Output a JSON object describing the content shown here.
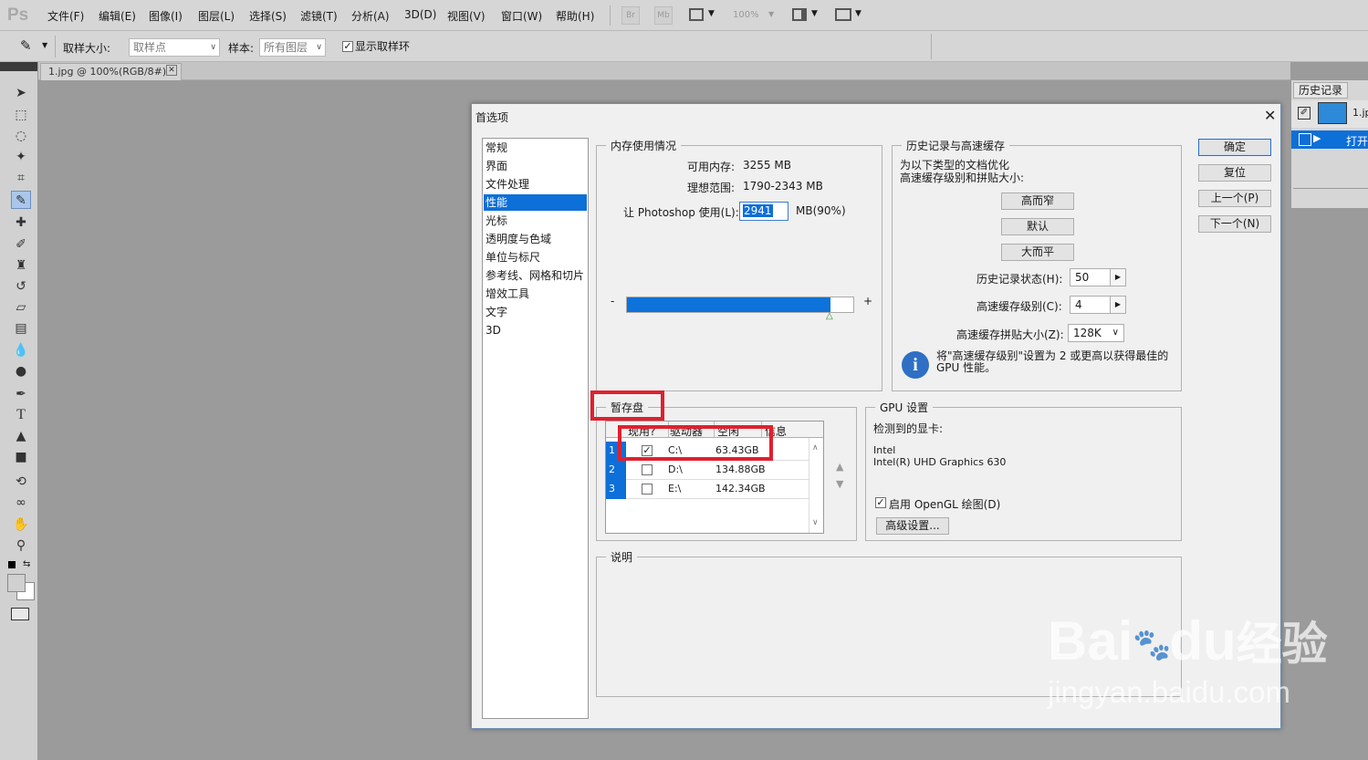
{
  "app": {
    "logo": "Ps"
  },
  "menu": [
    "文件(F)",
    "编辑(E)",
    "图像(I)",
    "图层(L)",
    "选择(S)",
    "滤镜(T)",
    "分析(A)",
    "3D(D)",
    "视图(V)",
    "窗口(W)",
    "帮助(H)"
  ],
  "menubar_buttons": {
    "br": "Br",
    "mb": "Mb",
    "zoom": "100%"
  },
  "options": {
    "sample_size_label": "取样大小:",
    "sample_size_value": "取样点",
    "sample_label": "样本:",
    "sample_value": "所有图层",
    "show_ring_label": "显示取样环"
  },
  "doc_tab": {
    "title": "1.jpg @ 100%(RGB/8#)"
  },
  "history_panel": {
    "tab": "历史记录",
    "doc": "1.jpg",
    "state": "打开"
  },
  "dialog": {
    "title": "首选项",
    "nav": [
      "常规",
      "界面",
      "文件处理",
      "性能",
      "光标",
      "透明度与色域",
      "单位与标尺",
      "参考线、网格和切片",
      "增效工具",
      "文字",
      "3D"
    ],
    "nav_selected": 3,
    "buttons": {
      "ok": "确定",
      "reset": "复位",
      "prev": "上一个(P)",
      "next": "下一个(N)"
    },
    "memory": {
      "title": "内存使用情况",
      "available_label": "可用内存:",
      "available_value": "3255 MB",
      "ideal_label": "理想范围:",
      "ideal_value": "1790-2343 MB",
      "use_label": "让 Photoshop 使用(L):",
      "use_value": "2941",
      "use_suffix": "MB(90%)",
      "slider_fill": 0.9,
      "minus": "-",
      "plus": "+"
    },
    "history_cache": {
      "title": "历史记录与高速缓存",
      "desc": "为以下类型的文档优化\n高速缓存级别和拼贴大小:",
      "btn_tall_thin": "高而窄",
      "btn_default": "默认",
      "btn_big_flat": "大而平",
      "history_states_label": "历史记录状态(H):",
      "history_states_value": "50",
      "cache_levels_label": "高速缓存级别(C):",
      "cache_levels_value": "4",
      "tile_size_label": "高速缓存拼贴大小(Z):",
      "tile_size_value": "128K",
      "info": "将\"高速缓存级别\"设置为 2 或更高以获得最佳的\nGPU 性能。"
    },
    "scratch": {
      "title": "暂存盘",
      "columns": [
        "现用?",
        "驱动器",
        "空闲",
        "信息"
      ],
      "rows": [
        {
          "n": "1",
          "checked": true,
          "drive": "C:\\",
          "free": "63.43GB"
        },
        {
          "n": "2",
          "checked": false,
          "drive": "D:\\",
          "free": "134.88GB"
        },
        {
          "n": "3",
          "checked": false,
          "drive": "E:\\",
          "free": "142.34GB"
        }
      ]
    },
    "gpu": {
      "title": "GPU 设置",
      "detected_label": "检测到的显卡:",
      "vendor": "Intel",
      "model": "Intel(R) UHD Graphics 630",
      "opengl_label": "启用 OpenGL 绘图(D)",
      "advanced_button": "高级设置..."
    },
    "description": {
      "title": "说明"
    }
  },
  "watermark": {
    "brand": "Bai",
    "brand2": "du",
    "brand3": "经验",
    "url": "jingyan.baidu.com"
  }
}
